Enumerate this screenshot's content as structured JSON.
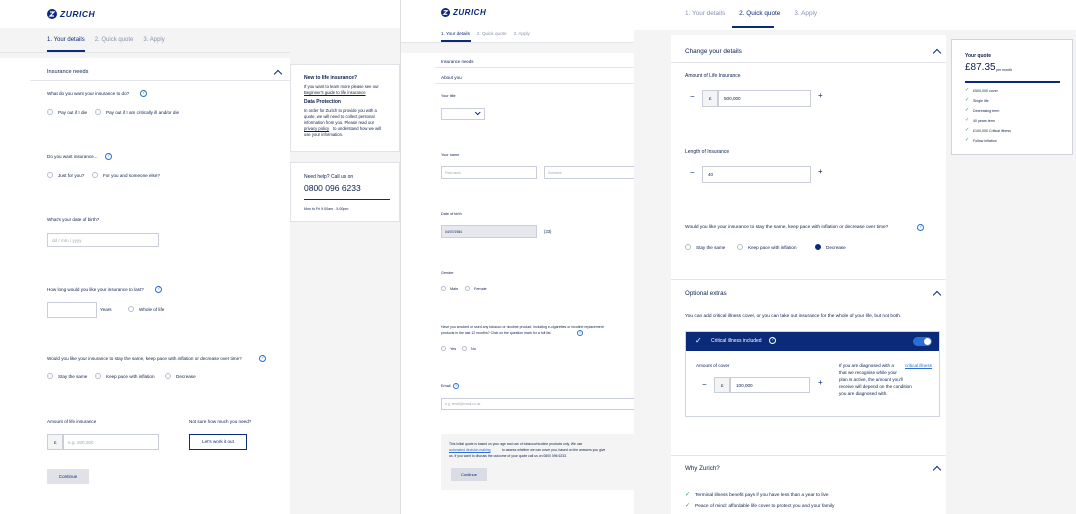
{
  "brand": {
    "name": "ZURICH"
  },
  "steps": {
    "s1": "1. Your details",
    "s2": "2. Quick quote",
    "s3": "3. Apply"
  },
  "left": {
    "section": "Insurance needs",
    "q1": "What do you want your insurance to do?",
    "q1_opt1": "Pay out if I die",
    "q1_opt2": "Pay out if I am critically ill and/or die",
    "q2": "Do you want insurance...",
    "q2_opt1": "Just for you?",
    "q2_opt2": "For you and someone else?",
    "q3": "What's your date of birth?",
    "dob_placeholder": "dd / mm / yyyy",
    "q4": "How long would you like your insurance to last?",
    "years": "Years",
    "whole": "Whole of life",
    "q5": "Would you like your insurance to stay the same, keep pace with inflation or decrease over time?",
    "q5_opt1": "Stay the same",
    "q5_opt2": "Keep pace with inflation",
    "q5_opt3": "Decrease",
    "amount_label": "Amount of life insurance",
    "currency": "£",
    "amount_placeholder": "e.g. 200,000",
    "not_sure": "Not sure how much you need?",
    "work_btn": "Let's work it out",
    "continue": "Continue"
  },
  "sidebar": {
    "title": "New to life insurance?",
    "intro": "If you want to learn more please see our",
    "guide_link": "Beginner's guide to life insurance",
    "dp_title": "Data Protection",
    "dp1": "In order for Zurich to provide you with a",
    "dp2": "quote, we will need to collect personal",
    "dp3": "information from you. Please read our",
    "dp_link": "privacy policy",
    "dp4": "to understand how we will",
    "dp5": "use your information.",
    "help_title": "Need help? Call us on",
    "phone": "0800 096 6233",
    "hours": "Mon to Fri 9.00am - 5.00pm"
  },
  "middle": {
    "section": "Insurance needs",
    "about": "About you",
    "title_label": "Your title",
    "name_label": "Your name",
    "first_ph": "First name",
    "surname_ph": "Surname",
    "dob_label": "Date of birth",
    "dob_value": "04/07/1984",
    "age": "(33)",
    "gender_label": "Gender",
    "male": "Male",
    "female": "Female",
    "smoke1": "Have you smoked or used any tobacco or nicotine product, including e-cigarettes or nicotine replacement",
    "smoke2": "products in the last 12 months? Click on the question mark for a full list.",
    "yes": "Yes",
    "no": "No",
    "email_label": "Email",
    "email_ph": "e.g. email@email.co.uk",
    "disc1": "This initial quote is based on your age and use of tobacco/nicotine products only. We use",
    "disc_link": "automated decision-making",
    "disc2": "to assess whether we can cover you, based on the answers you give",
    "disc3": "us. If you want to discuss the outcome of your quote call us on 0800 096 6233.",
    "continue": "Continue"
  },
  "right": {
    "change": "Change your details",
    "amount_label": "Amount of Life Insurance",
    "currency": "£",
    "amount_value": "500,000",
    "length_label": "Length of Insurance",
    "length_value": "40",
    "q": "Would you like your insurance to stay the same, keep pace with inflation or decrease over time?",
    "opt1": "Stay the same",
    "opt2": "Keep pace with inflation",
    "opt3": "Decrease",
    "optional": "Optional extras",
    "optional_desc": "You can add critical illness cover, or you can take out insurance for the whole of your life, but not both.",
    "ci_label": "Critical illness included",
    "ci_amount_label": "Amount of cover",
    "ci_value": "100,000",
    "ci_text1": "If you are diagnosed with a",
    "ci_link": "critical illness",
    "ci_text2": "that we recognise while your",
    "ci_text3": "plan is active, the amount you'll",
    "ci_text4": "receive will depend on the condition",
    "ci_text5": "you are diagnosed with.",
    "why": "Why Zurich?",
    "why1": "Terminal illness benefit pays if you have less than a year to live",
    "why2": "Peace of mind: affordable life cover to protect you and your family"
  },
  "quote": {
    "title": "Your quote",
    "price": "£87.35",
    "per": "per month",
    "items": [
      "£500,000 cover",
      "Single life",
      "Decreasing term",
      "40 years term",
      "£100,000 Critical illness",
      "Follow inflation"
    ]
  },
  "colors": {
    "brand": "#0b2a7a",
    "link": "#2a6ed6",
    "check": "#2aa148"
  }
}
